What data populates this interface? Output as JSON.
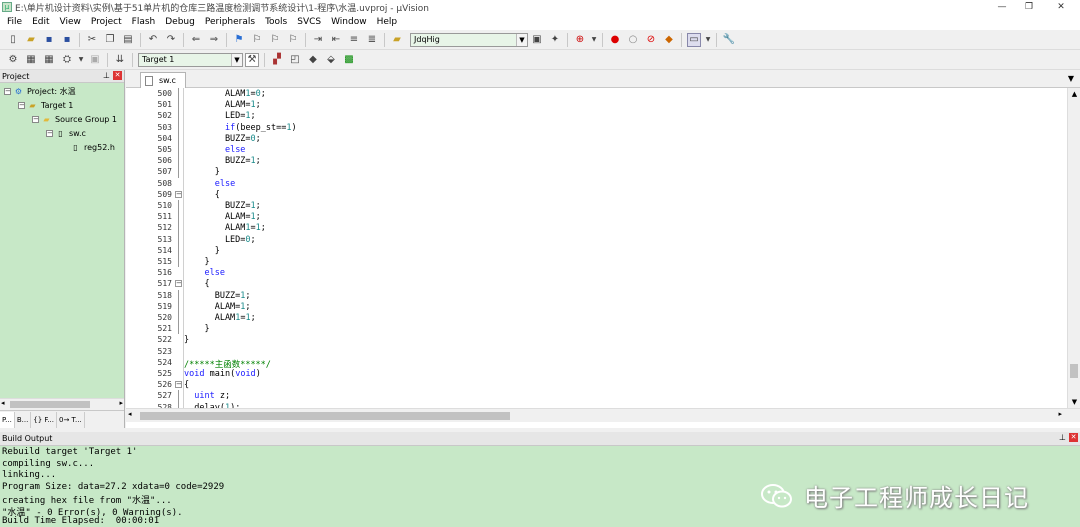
{
  "title": "E:\\单片机设计资料\\实例\\基于51单片机的仓库三路温度检测调节系统设计\\1-程序\\水温.uvproj - µVision",
  "window_controls": {
    "minimize": "—",
    "restore": "❐",
    "close": "✕"
  },
  "menu": [
    "File",
    "Edit",
    "View",
    "Project",
    "Flash",
    "Debug",
    "Peripherals",
    "Tools",
    "SVCS",
    "Window",
    "Help"
  ],
  "toolbar": {
    "find_combo": "JdqHig",
    "target_combo": "Target 1"
  },
  "project_panel": {
    "header": "Project",
    "tree": [
      {
        "label": "Project: 水温"
      },
      {
        "label": "Target 1"
      },
      {
        "label": "Source Group 1"
      },
      {
        "label": "sw.c"
      },
      {
        "label": "reg52.h"
      }
    ],
    "tabs": [
      "P...",
      "B...",
      "{} F...",
      "0→ T..."
    ]
  },
  "editor": {
    "file_tab": "sw.c",
    "line_numbers": [
      "500",
      "501",
      "502",
      "503",
      "504",
      "505",
      "506",
      "507",
      "508",
      "509",
      "510",
      "511",
      "512",
      "513",
      "514",
      "515",
      "516",
      "517",
      "518",
      "519",
      "520",
      "521",
      "522",
      "523",
      "524",
      "525",
      "526",
      "527",
      "528"
    ],
    "lines": [
      "        ALAM1=0;",
      "        ALAM=1;",
      "        LED=1;",
      "        if(beep_st==1)",
      "        BUZZ=0;",
      "        else",
      "        BUZZ=1;",
      "      }",
      "      else",
      "      {",
      "        BUZZ=1;",
      "        ALAM=1;",
      "        ALAM1=1;",
      "        LED=0;",
      "      }",
      "    }",
      "    else",
      "    {",
      "      BUZZ=1;",
      "      ALAM=1;",
      "      ALAM1=1;",
      "    }",
      "}",
      "",
      "/*****主函数*****/",
      "void main(void)",
      "{",
      "  uint z;",
      "  delay(1);"
    ]
  },
  "build_output": {
    "header": "Build Output",
    "lines": [
      "Rebuild target 'Target 1'",
      "compiling sw.c...",
      "linking...",
      "Program Size: data=27.2 xdata=0 code=2929",
      "creating hex file from \"水温\"...",
      "\"水温\" - 0 Error(s), 0 Warning(s).",
      "Build Time Elapsed:  00:00:01"
    ]
  },
  "watermark": "电子工程师成长日记"
}
